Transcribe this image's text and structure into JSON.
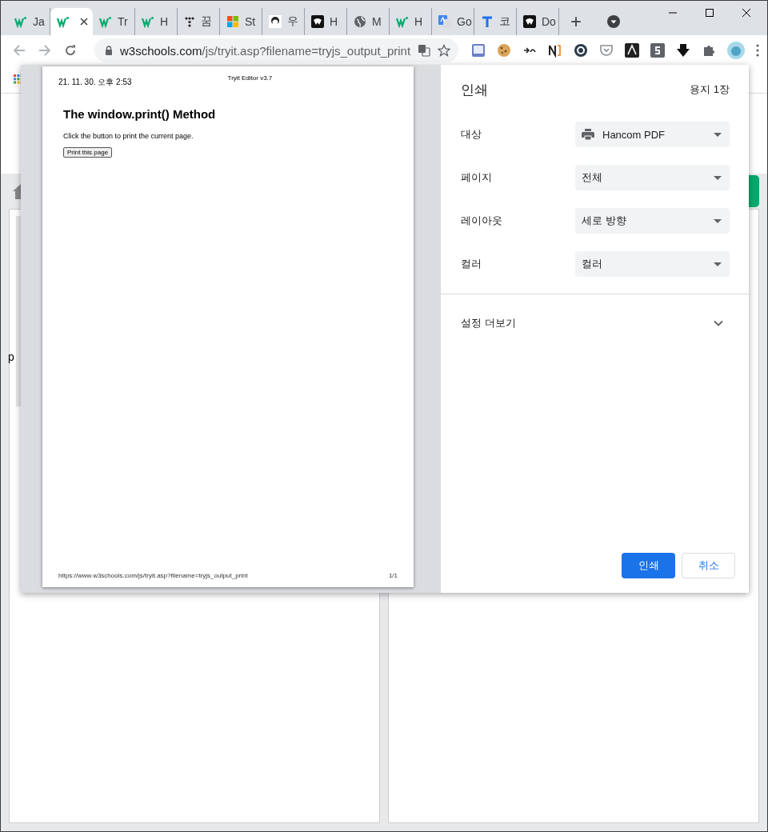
{
  "tabs": [
    {
      "label": "Ja",
      "selected": false
    },
    {
      "selected": true
    },
    {
      "label": "Tr",
      "selected": false
    },
    {
      "label": "H",
      "selected": false
    },
    {
      "label": "꿈",
      "selected": false
    },
    {
      "label": "St",
      "selected": false
    },
    {
      "label": "우",
      "selected": false
    },
    {
      "label": "H",
      "selected": false
    },
    {
      "label": "M",
      "selected": false
    },
    {
      "label": "H",
      "selected": false
    },
    {
      "label": "Go",
      "selected": false
    },
    {
      "label": "코",
      "selected": false
    },
    {
      "label": "Do",
      "selected": false
    }
  ],
  "new_tab": "+",
  "address": {
    "domain": "w3schools.com",
    "path": "/js/tryit.asp?filename=tryjs_output_print"
  },
  "background_page": {
    "code_text": "p"
  },
  "print_preview": {
    "header_left": "21. 11. 30. 오후 2:53",
    "header_center": "Tryit Editor v3.7",
    "heading": "The window.print() Method",
    "paragraph": "Click the button to print the current page.",
    "button": "Print this page",
    "footer_left": "https://www.w3schools.com/js/tryit.asp?filename=tryjs_output_print",
    "footer_right": "1/1"
  },
  "print_settings": {
    "title": "인쇄",
    "sheet_count": "용지 1장",
    "options": [
      {
        "label": "대상",
        "value": "Hancom PDF",
        "kind": "printer"
      },
      {
        "label": "페이지",
        "value": "전체",
        "kind": "plain"
      },
      {
        "label": "레이아웃",
        "value": "세로 방향",
        "kind": "plain"
      },
      {
        "label": "컬러",
        "value": "컬러",
        "kind": "plain"
      }
    ],
    "more_settings": {
      "label": "설정 더보기",
      "expanded": false
    },
    "buttons": [
      {
        "label": "인쇄",
        "kind": "primary"
      },
      {
        "label": "취소",
        "kind": "secondary"
      }
    ]
  }
}
